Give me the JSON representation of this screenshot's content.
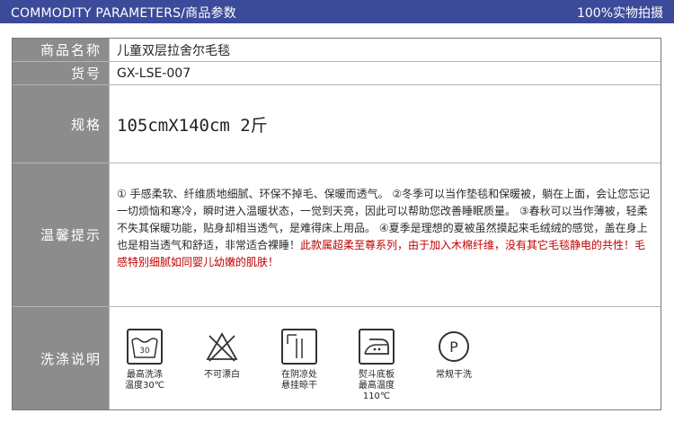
{
  "header": {
    "title": "COMMODITY PARAMETERS/商品参数",
    "right": "100%实物拍摄"
  },
  "params": [
    {
      "label": "商品名称",
      "value": "儿童双层拉舍尔毛毯"
    },
    {
      "label": "货号",
      "value": "GX-LSE-007"
    },
    {
      "label": "规格",
      "value": "105cmX140cm 2斤"
    }
  ],
  "tips": {
    "label": "温馨提示",
    "text": "① 手感柔软、纤维质地细腻、环保不掉毛、保暖而透气。 ②冬季可以当作垫毯和保暖被，躺在上面，会让您忘记一切烦恼和寒冷，瞬时进入温暖状态，一觉到天亮，因此可以帮助您改善睡眠质量。 ③春秋可以当作薄被，轻柔不失其保暖功能，贴身却相当透气，是难得床上用品。 ④夏季是理想的夏被虽然摸起来毛绒绒的感觉，盖在身上也是相当透气和舒适，非常适合裸睡！",
    "highlight": "此款属超柔至尊系列，由于加入木棉纤维，没有其它毛毯静电的共性！毛感特别细腻如同婴儿幼嫩的肌肤！"
  },
  "care": {
    "label": "洗涤说明",
    "items": [
      {
        "icon": "wash-30-icon",
        "number": "30",
        "line1": "最高洗涤",
        "line2": "温度30℃"
      },
      {
        "icon": "no-bleach-icon",
        "line1": "不可漂白",
        "line2": ""
      },
      {
        "icon": "line-dry-shade-icon",
        "line1": "在阴凉处",
        "line2": "悬挂晾干"
      },
      {
        "icon": "iron-icon",
        "line1": "熨斗底板",
        "line2": "最高温度110℃"
      },
      {
        "icon": "dry-clean-p-icon",
        "letter": "P",
        "line1": "常规干洗",
        "line2": ""
      }
    ]
  }
}
